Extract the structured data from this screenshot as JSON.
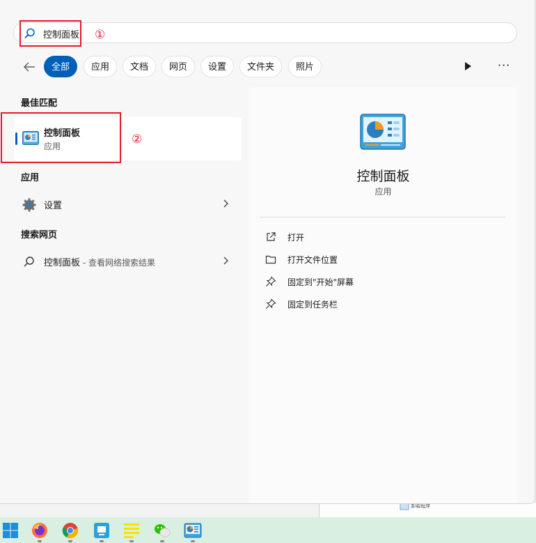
{
  "search": {
    "query": "控制面板"
  },
  "annotations": {
    "step1": "①",
    "step2": "②"
  },
  "filters": [
    {
      "label": "全部",
      "active": true
    },
    {
      "label": "应用"
    },
    {
      "label": "文档"
    },
    {
      "label": "网页"
    },
    {
      "label": "设置"
    },
    {
      "label": "文件夹"
    },
    {
      "label": "照片"
    }
  ],
  "more_label": "···",
  "sections": {
    "best_match": "最佳匹配",
    "apps": "应用",
    "web": "搜索网页"
  },
  "best_match": {
    "title": "控制面板",
    "subtitle": "应用"
  },
  "app_items": [
    {
      "label": "设置"
    }
  ],
  "web_items": [
    {
      "label": "控制面板",
      "suffix": " - 查看网络搜索结果"
    }
  ],
  "detail": {
    "title": "控制面板",
    "subtitle": "应用",
    "actions": [
      {
        "label": "打开",
        "icon": "open-external-icon"
      },
      {
        "label": "打开文件位置",
        "icon": "folder-icon"
      },
      {
        "label": "固定到\"开始\"屏幕",
        "icon": "pin-icon"
      },
      {
        "label": "固定到任务栏",
        "icon": "pin-icon"
      }
    ]
  },
  "background": {
    "label": "卸载程序"
  },
  "taskbar": [
    "windows-start-icon",
    "firefox-icon",
    "chrome-icon",
    "app-icon",
    "notes-icon",
    "wechat-icon",
    "control-panel-icon"
  ],
  "colors": {
    "accent": "#005fb8",
    "annotation_red": "#e8172c",
    "taskbar": "#d9efe2"
  }
}
